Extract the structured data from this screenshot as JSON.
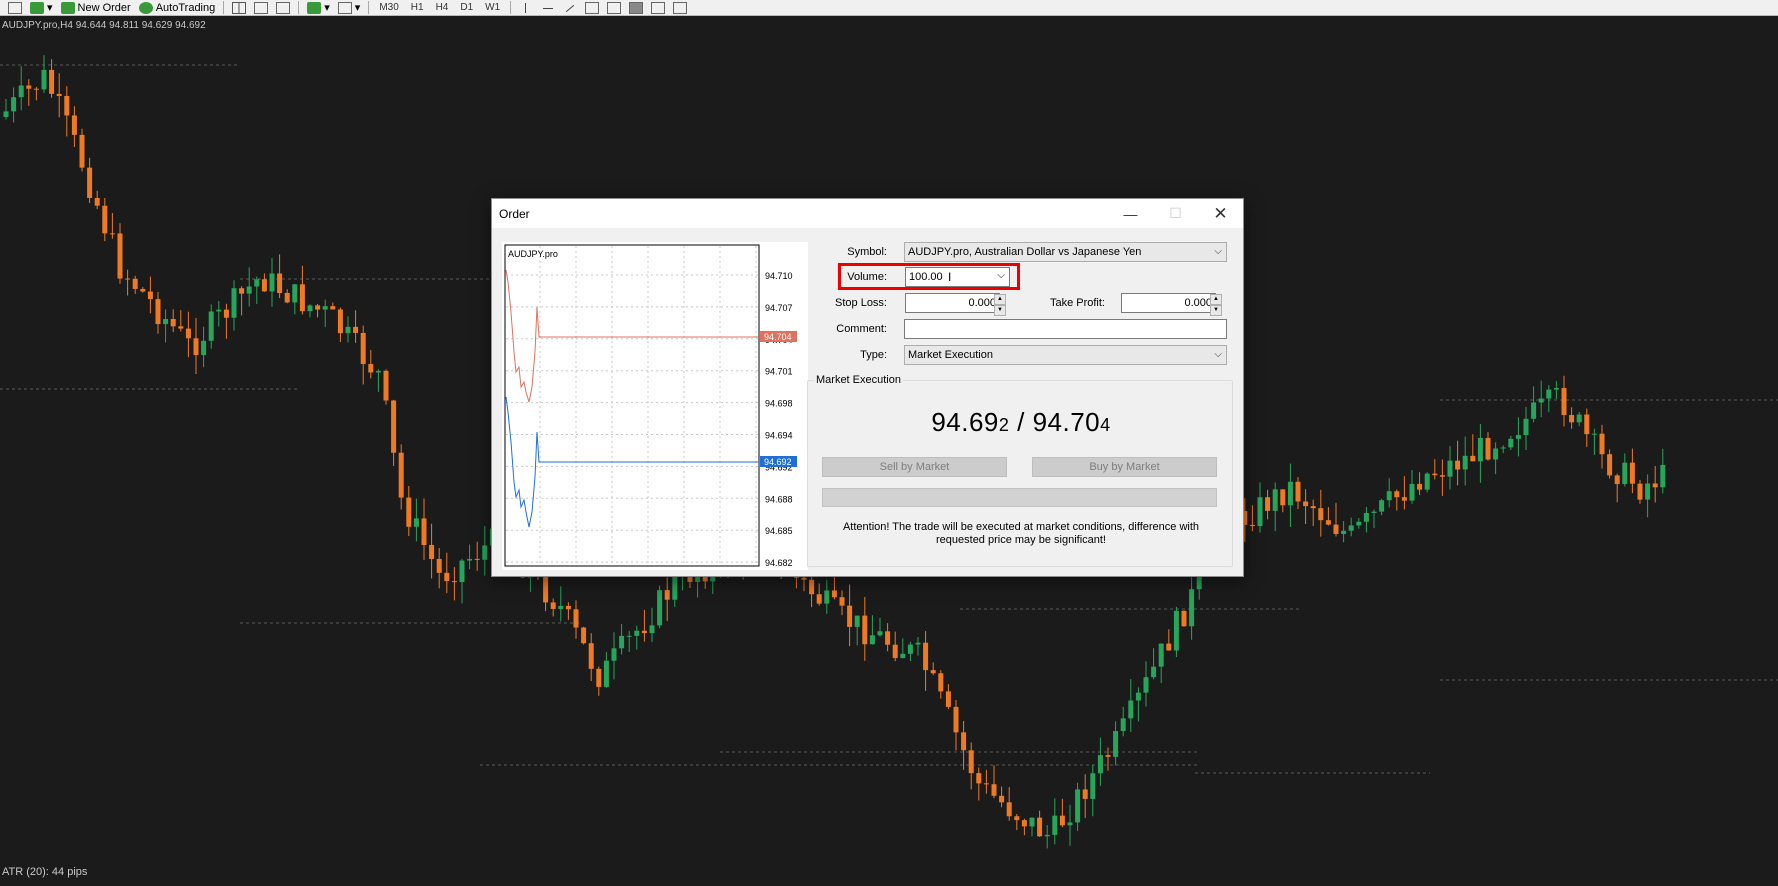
{
  "toolbar": {
    "new_order": "New Order",
    "auto_trading": "AutoTrading",
    "timeframes": [
      "M30",
      "H1",
      "H4",
      "D1",
      "W1"
    ]
  },
  "chart": {
    "symbol_info": "AUDJPY.pro,H4  94.644 94.811 94.629 94.692",
    "atr_label": "ATR (20): 44 pips",
    "bull_color": "#26a65b",
    "bear_color": "#f07a24"
  },
  "dialog": {
    "title": "Order",
    "minimize_icon": "minimize-icon",
    "maximize_icon": "maximize-icon",
    "close_icon": "close-icon",
    "mini_chart": {
      "symbol": "AUDJPY.pro",
      "price_labels": [
        "94.710",
        "94.707",
        "94.704",
        "94.701",
        "94.698",
        "94.694",
        "94.692",
        "94.688",
        "94.685",
        "94.682"
      ],
      "ask_tag": "94.704",
      "bid_tag": "94.692",
      "ask_color": "#e07060",
      "bid_color": "#1e6fd8"
    },
    "form": {
      "symbol_label": "Symbol:",
      "symbol_value": "AUDJPY.pro, Australian Dollar vs Japanese Yen",
      "volume_label": "Volume:",
      "volume_value": "100.00",
      "stop_loss_label": "Stop Loss:",
      "stop_loss_value": "0.000",
      "take_profit_label": "Take Profit:",
      "take_profit_value": "0.000",
      "comment_label": "Comment:",
      "comment_value": "",
      "type_label": "Type:",
      "type_value": "Market Execution"
    },
    "market": {
      "group_title": "Market Execution",
      "bid_main": "94.69",
      "bid_small": "2",
      "separator": " / ",
      "ask_main": "94.70",
      "ask_small": "4",
      "sell_label": "Sell by Market",
      "buy_label": "Buy by Market",
      "attention_line1": "Attention! The trade will be executed at market conditions, difference with",
      "attention_line2": "requested price may be significant!"
    }
  }
}
